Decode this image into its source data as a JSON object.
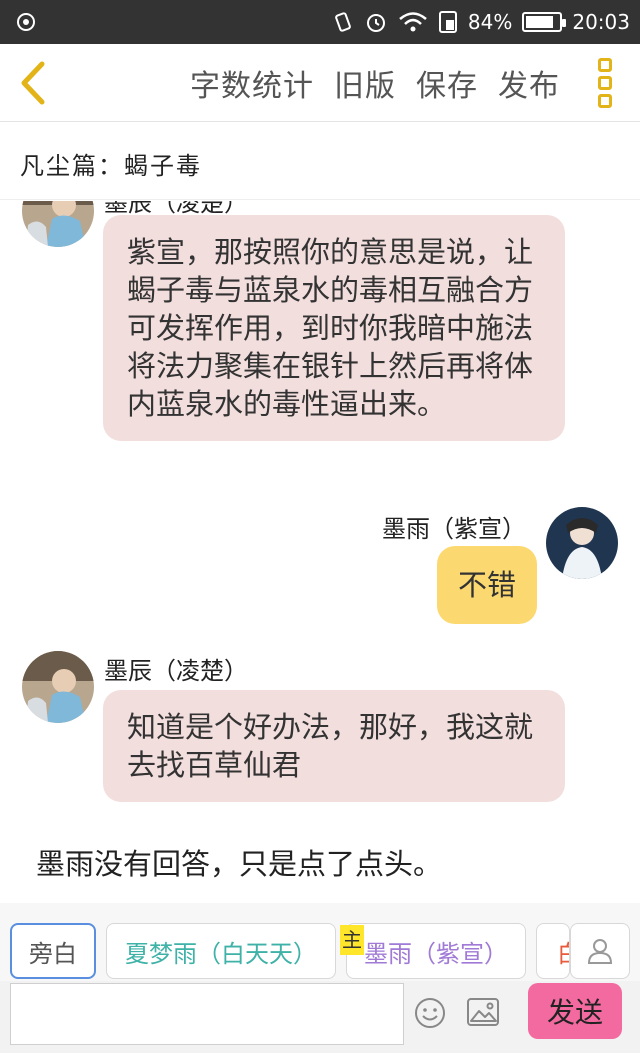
{
  "status_bar": {
    "battery": "84%",
    "battery_level": 0.84,
    "time": "20:03"
  },
  "toolbar": {
    "word_count": "字数统计",
    "old_version": "旧版",
    "save": "保存",
    "publish": "发布"
  },
  "title": "凡尘篇：蝎子毒",
  "chat": {
    "messages": [
      {
        "speaker": "墨辰（凌楚）",
        "side": "left",
        "text": "紫宣，那按照你的意思是说，让蝎子毒与蓝泉水的毒相互融合方可发挥作用，到时你我暗中施法将法力聚集在银针上然后再将体内蓝泉水的毒性逼出来。"
      },
      {
        "speaker": "墨雨（紫宣）",
        "side": "right",
        "text": "不错"
      },
      {
        "speaker": "墨辰（凌楚）",
        "side": "left",
        "text": "知道是个好办法，那好，我这就去找百草仙君"
      }
    ],
    "narration": "墨雨没有回答，只是点了点头。"
  },
  "roles": {
    "narrator": "旁白",
    "role1": "夏梦雨（白天天）",
    "main_badge": "主",
    "role2": "墨雨（紫宣）",
    "role3_partial": "白"
  },
  "input": {
    "value": "",
    "placeholder": "",
    "send": "发送"
  },
  "colors": {
    "status_bar": "#333333",
    "accent_yellow": "#e2b418",
    "bubble_pink": "#f3dede",
    "bubble_yellow": "#fcd970",
    "role1_text": "#3fb2a8",
    "role2_text": "#a07ad6",
    "role3_text": "#e85a3a",
    "send_button": "#f36aa0"
  }
}
